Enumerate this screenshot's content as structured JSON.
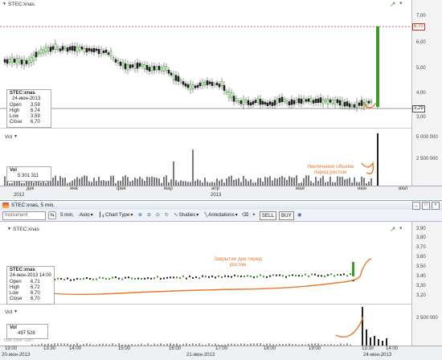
{
  "top_chart": {
    "symbol": "STEC:xnas",
    "price_axis": {
      "ticks": [
        "7,00",
        "6,70",
        "6,00",
        "5,00",
        "4,00",
        "3,29",
        "3,00"
      ],
      "last_price": "6,70",
      "ref_price": "3,29"
    },
    "info": {
      "symbol": "STEC:xnas",
      "date": "24-июн-2013",
      "rows": [
        {
          "k": "Open",
          "v": "3,59"
        },
        {
          "k": "High",
          "v": "6,74"
        },
        {
          "k": "Low",
          "v": "3,59"
        },
        {
          "k": "Close",
          "v": "6,70"
        }
      ]
    },
    "volume": {
      "label": "Vol",
      "info_label": "Vol",
      "info_value": "5 301 311",
      "ticks": [
        "5 000 000",
        "2 500 000"
      ],
      "annotation": "Увеличение объема перед ростом"
    },
    "months": [
      "дек",
      "янв",
      "фев",
      "мар",
      "апр",
      "май",
      "июн",
      "июл"
    ],
    "years": [
      "2012",
      "2013"
    ]
  },
  "window": {
    "title": "STEC:xnas, 5 min."
  },
  "toolbar": {
    "instrument_placeholder": "Instrument",
    "interval": "5 min,",
    "auto": "Auto",
    "chart_type": "Chart Type",
    "studies": "Studies",
    "annotations": "Annotations",
    "sell": "SELL",
    "buy": "BUY"
  },
  "bottom_chart": {
    "symbol": "STEC:xnas",
    "price_axis": {
      "ticks": [
        "3,90",
        "3,80",
        "3,70",
        "3,60",
        "3,50",
        "3,40",
        "3,30",
        "3,20"
      ]
    },
    "annotation": "Закрытие дня перед ростом",
    "info": {
      "symbol": "STEC:xnas",
      "date": "24-июн-2013 14:00",
      "rows": [
        {
          "k": "Open",
          "v": "6,71"
        },
        {
          "k": "High",
          "v": "6,72"
        },
        {
          "k": "Low",
          "v": "6,70"
        },
        {
          "k": "Close",
          "v": "6,70"
        }
      ]
    },
    "volume": {
      "label": "Vol",
      "info_label": "Vol",
      "info_value": "497 528",
      "ticks": [
        "2 500 000"
      ],
      "timezone": "Time Zone: GMT"
    },
    "times": [
      "19:00",
      "13:30",
      "14:00",
      "15:00",
      "16:00",
      "17:00",
      "18:00",
      "19:00",
      "13:30",
      "14:00"
    ],
    "dates": [
      "20-июн-2013",
      "21-июн-2013",
      "24-июн-2013"
    ]
  },
  "colors": {
    "up": "#3a9a2a",
    "down": "#222222",
    "annotation": "#e8792a",
    "last": "#c0392b"
  }
}
